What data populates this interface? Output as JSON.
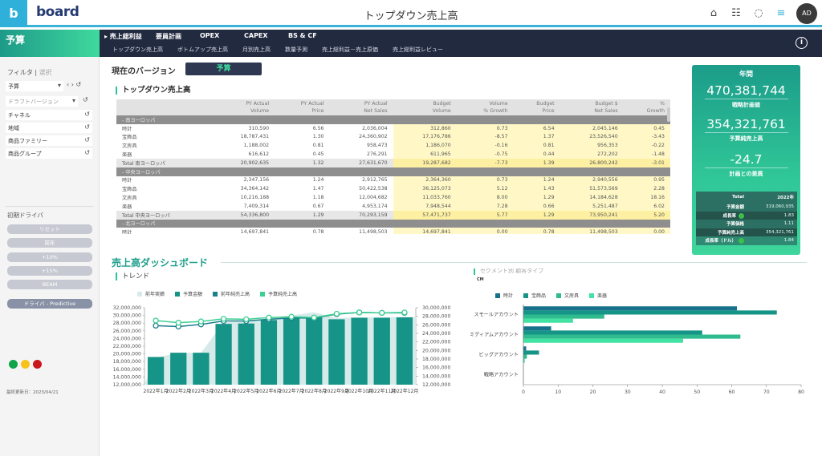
{
  "app": {
    "logo_letter": "b",
    "logo_word": "board",
    "title": "トップダウン売上高",
    "avatar": "AD"
  },
  "top_icons": [
    "home-icon",
    "presentation-icon",
    "chat-icon",
    "menu-notification-icon"
  ],
  "nav": {
    "brand": "予算",
    "main": [
      "▸ 売上総利益",
      "要員計画",
      "OPEX",
      "CAPEX",
      "BS & CF"
    ],
    "sub": [
      "トップダウン売上高",
      "ボトムアップ売上高",
      "月別売上高",
      "数量予測",
      "売上総利益－売上原価",
      "売上総利益レビュー"
    ]
  },
  "sidebar": {
    "filter_label": "フィルタ",
    "filter_select_label": "選択",
    "version_select": "予算",
    "draft_select_placeholder": "ドラフトバージョン",
    "filters": [
      "チャネル",
      "地域",
      "商品ファミリー",
      "商品グループ"
    ],
    "driver_title": "初期ドライバ",
    "driver_buttons": [
      "リセット",
      "前年",
      "+10%",
      "+15%",
      "BEAM"
    ],
    "predictive_button": "ドライバ - Predictive",
    "status_colors": [
      "#0fa34a",
      "#f7c219",
      "#c9171c"
    ],
    "last_updated": "最終更新日：2023/04/21"
  },
  "version": {
    "label": "現在のバージョン",
    "value": "予算"
  },
  "table": {
    "title": "トップダウン売上高",
    "headers": [
      [
        "",
        ""
      ],
      [
        "PY Actual",
        "Volume"
      ],
      [
        "PY Actual",
        "Price"
      ],
      [
        "PY Actual",
        "Net Sales"
      ],
      [
        "Budget",
        "Volume"
      ],
      [
        "Volume",
        "% Growth"
      ],
      [
        "Budget",
        "Price"
      ],
      [
        "Budget $",
        "Net Sales"
      ],
      [
        "%",
        "Growth"
      ]
    ],
    "rows": [
      {
        "type": "group",
        "cells": [
          "- 南ヨーロッパ"
        ]
      },
      {
        "type": "data",
        "cells": [
          "時計",
          "310,590",
          "6.56",
          "2,036,004",
          "312,860",
          "0.73",
          "6.54",
          "2,045,146",
          "0.45"
        ]
      },
      {
        "type": "data",
        "cells": [
          "宝飾品",
          "18,787,431",
          "1.30",
          "24,360,902",
          "17,176,786",
          "-8.57",
          "1.37",
          "23,526,540",
          "-3.43"
        ]
      },
      {
        "type": "data",
        "cells": [
          "文房具",
          "1,188,002",
          "0.81",
          "958,473",
          "1,186,070",
          "-0.16",
          "0.81",
          "956,353",
          "-0.22"
        ]
      },
      {
        "type": "data",
        "cells": [
          "楽器",
          "616,612",
          "0.45",
          "276,291",
          "611,965",
          "-0.75",
          "0.44",
          "272,202",
          "-1.48"
        ]
      },
      {
        "type": "total",
        "cells": [
          "Total 南ヨーロッパ",
          "20,902,635",
          "1.32",
          "27,631,670",
          "19,287,682",
          "-7.73",
          "1.39",
          "26,800,242",
          "-3.01"
        ]
      },
      {
        "type": "group",
        "cells": [
          "- 中央ヨーロッパ"
        ]
      },
      {
        "type": "data",
        "cells": [
          "時計",
          "2,347,156",
          "1.24",
          "2,912,765",
          "2,364,360",
          "0.73",
          "1.24",
          "2,940,556",
          "0.95"
        ]
      },
      {
        "type": "data",
        "cells": [
          "宝飾品",
          "34,364,142",
          "1.47",
          "50,422,538",
          "36,125,073",
          "5.12",
          "1.43",
          "51,573,569",
          "2.28"
        ]
      },
      {
        "type": "data",
        "cells": [
          "文房具",
          "10,216,188",
          "1.18",
          "12,004,682",
          "11,033,760",
          "8.00",
          "1.29",
          "14,184,628",
          "18.16"
        ]
      },
      {
        "type": "data",
        "cells": [
          "楽器",
          "7,409,314",
          "0.67",
          "4,953,174",
          "7,948,544",
          "7.28",
          "0.66",
          "5,251,487",
          "6.02"
        ]
      },
      {
        "type": "total",
        "cells": [
          "Total 中央ヨーロッパ",
          "54,336,800",
          "1.29",
          "70,293,159",
          "57,471,737",
          "5.77",
          "1.29",
          "73,950,241",
          "5.20"
        ]
      },
      {
        "type": "group",
        "cells": [
          "- 北ヨーロッパ"
        ]
      },
      {
        "type": "data",
        "cells": [
          "時計",
          "14,697,841",
          "0.78",
          "11,498,503",
          "14,697,841",
          "0.00",
          "0.78",
          "11,498,503",
          "0.00"
        ]
      }
    ]
  },
  "kpi": {
    "header": "年間",
    "items": [
      {
        "value": "470,381,744",
        "label": "戦略計画値"
      },
      {
        "value": "354,321,761",
        "label": "予算純売上高"
      },
      {
        "value": "-24.7",
        "label": "計画との差異"
      }
    ],
    "table": {
      "header": [
        "Total",
        "2022年"
      ],
      "rows": [
        {
          "label": "予算金額",
          "value": "319,060,935",
          "dot": false
        },
        {
          "label": "成長率",
          "value": "1.83",
          "dot": true
        },
        {
          "label": "予算価格",
          "value": "1.11",
          "dot": false
        },
        {
          "label": "予算純売上高",
          "value": "354,321,761",
          "dot": false
        },
        {
          "label": "成長率（ドル）",
          "value": "1.84",
          "dot": true
        }
      ]
    }
  },
  "dashboard": {
    "title": "売上高ダッシュボード"
  },
  "chart_data": [
    {
      "type": "bar",
      "title": "トレンド",
      "categories": [
        "2022年1月",
        "2022年2月",
        "2022年3月",
        "2022年4月",
        "2022年5月",
        "2022年6月",
        "2022年7月",
        "2022年8月",
        "2022年9月",
        "2022年10月",
        "2022年11月",
        "2022年12月"
      ],
      "series": [
        {
          "name": "前年実績",
          "kind": "area",
          "axis": "left",
          "color": "#d6ebe9",
          "values": [
            19000000,
            20300000,
            20300000,
            28200000,
            28500000,
            29300000,
            30000000,
            30800000,
            29300000,
            29500000,
            29500000,
            29600000
          ]
        },
        {
          "name": "予算金額",
          "kind": "bar",
          "axis": "left",
          "color": "#169488",
          "values": [
            19200000,
            20300000,
            20300000,
            27800000,
            27900000,
            28800000,
            29300000,
            29500000,
            29000000,
            29400000,
            29400000,
            29500000
          ]
        },
        {
          "name": "前年純売上高",
          "kind": "line",
          "axis": "right",
          "color": "#1b7f8c",
          "values": [
            25800000,
            25600000,
            26100000,
            26900000,
            26900000,
            27300000,
            27600000,
            27600000,
            28500000,
            28900000,
            28800000,
            28800000
          ]
        },
        {
          "name": "予算純売上高",
          "kind": "line",
          "axis": "right",
          "color": "#3ccf92",
          "values": [
            27000000,
            26500000,
            26800000,
            27400000,
            27300000,
            27700000,
            27900000,
            27700000,
            28600000,
            28900000,
            28800000,
            28900000
          ]
        }
      ],
      "y_left": {
        "min": 12000000,
        "max": 32000000,
        "ticks": [
          "12,000,000",
          "14,000,000",
          "16,000,000",
          "18,000,000",
          "20,000,000",
          "22,000,000",
          "24,000,000",
          "26,000,000",
          "28,000,000",
          "30,000,000",
          "32,000,000"
        ]
      },
      "y_right": {
        "min": 12000000,
        "max": 30000000,
        "ticks": [
          "12,000,000",
          "14,000,000",
          "16,000,000",
          "18,000,000",
          "20,000,000",
          "22,000,000",
          "24,000,000",
          "26,000,000",
          "28,000,000",
          "30,000,000"
        ]
      },
      "legend_position": "top-left"
    },
    {
      "type": "bar",
      "orientation": "horizontal",
      "title": "セグメント別 顧客タイプ",
      "subtitle": "CM",
      "categories": [
        "スモールアカウント",
        "ミディアムアカウント",
        "ビッグアカウント",
        "戦略アカウント"
      ],
      "series": [
        {
          "name": "時計",
          "color": "#17718a",
          "values": [
            61.5,
            8,
            0.8,
            0
          ]
        },
        {
          "name": "宝飾品",
          "color": "#169488",
          "values": [
            73,
            51.5,
            4.5,
            0
          ]
        },
        {
          "name": "文房具",
          "color": "#2fbb8e",
          "values": [
            23.3,
            62.5,
            1,
            0
          ]
        },
        {
          "name": "楽器",
          "color": "#42e3a2",
          "values": [
            14.3,
            46,
            0.4,
            0
          ]
        }
      ],
      "x_axis": {
        "min": 0,
        "max": 80,
        "ticks": [
          "0",
          "10",
          "20",
          "30",
          "40",
          "50",
          "60",
          "70",
          "80"
        ]
      },
      "legend_position": "top-left"
    }
  ]
}
